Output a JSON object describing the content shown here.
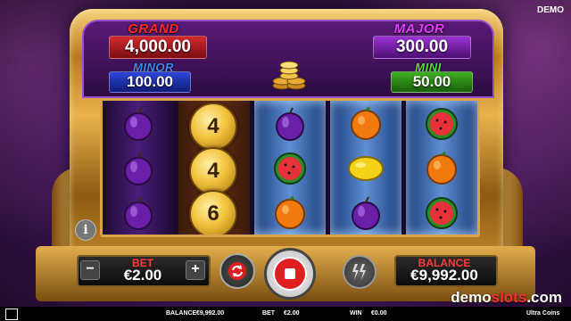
{
  "demo_badge": "DEMO",
  "jackpots": {
    "grand": {
      "label": "GRAND",
      "value": "4,000.00",
      "label_color": "#ff2a2a",
      "box_color": "#a3151b"
    },
    "major": {
      "label": "MAJOR",
      "value": "300.00",
      "label_color": "#e33cff",
      "box_color": "#7b1fa8"
    },
    "minor": {
      "label": "MINOR",
      "value": "100.00",
      "label_color": "#3f8cff",
      "box_color": "#1c2fa8"
    },
    "mini": {
      "label": "MINI",
      "value": "50.00",
      "label_color": "#55e03a",
      "box_color": "#2e8a1a"
    }
  },
  "reels": [
    {
      "type": "purple",
      "symbols": [
        "plum-icon",
        "plum-icon",
        "plum-icon"
      ]
    },
    {
      "type": "coins",
      "symbols": [
        "4",
        "4",
        "6"
      ]
    },
    {
      "type": "blue",
      "symbols": [
        "plum-icon",
        "watermelon-icon",
        "orange-icon"
      ]
    },
    {
      "type": "blue",
      "symbols": [
        "orange-icon",
        "lemon-icon",
        "plum-icon"
      ]
    },
    {
      "type": "blue",
      "symbols": [
        "watermelon-icon",
        "orange-icon",
        "watermelon-icon"
      ]
    }
  ],
  "bet": {
    "label": "BET",
    "value": "€2.00"
  },
  "balance": {
    "label": "BALANCE",
    "value": "€9,992.00"
  },
  "buttons": {
    "minus": "−",
    "plus": "+",
    "info": "i"
  },
  "status_bar": {
    "balance_label": "BALANCE",
    "balance_value": "€9,992.00",
    "bet_label": "BET",
    "bet_value": "€2.00",
    "win_label": "WIN",
    "win_value": "€0.00",
    "game_name": "Ultra Coins"
  },
  "watermark": {
    "part1": "demo",
    "part2": "slots",
    "part3": ".com"
  }
}
